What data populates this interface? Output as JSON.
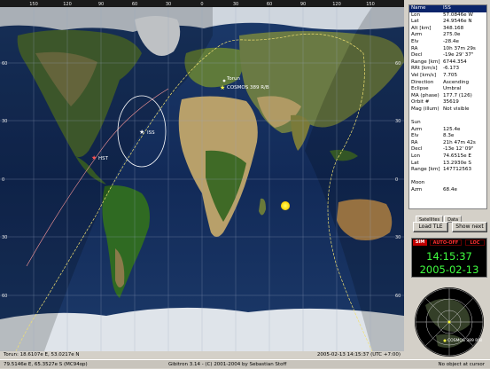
{
  "map": {
    "top_ticks": [
      "150",
      "120",
      "90",
      "60",
      "30",
      "0",
      "30",
      "60",
      "90",
      "120",
      "150"
    ],
    "side_ticks": [
      "60",
      "30",
      "0",
      "30",
      "60"
    ],
    "satellites": [
      {
        "name": "ISS",
        "color": "#ffffff"
      },
      {
        "name": "HST",
        "color": "#ff6a6a"
      },
      {
        "name": "COSMOS 389 R/B",
        "color": "#ffff40"
      }
    ],
    "ground_station": "Torun",
    "sun_color": "#ffd700",
    "status_left": "Torun: 18.6107e E, 53.0217e N",
    "status_right": "2005-02-13 14:15:37 (UTC +7:00)"
  },
  "bottom_status": {
    "cursor": "79.5146e E, 65.3527e S (MC94op)",
    "title": "Gibitron 3.14 - (C) 2001-2004 by Sebastian Stoff",
    "object": "No object at cursor"
  },
  "info": {
    "rows": [
      {
        "k": "Name",
        "v": "ISS",
        "selected": true
      },
      {
        "k": "Lon",
        "v": "57.0846e W"
      },
      {
        "k": "Lat",
        "v": "24.9546e N"
      },
      {
        "k": "Alt [km]",
        "v": "348.168"
      },
      {
        "k": "Azm",
        "v": "275.0e"
      },
      {
        "k": "Elv",
        "v": "-28.4e"
      },
      {
        "k": "RA",
        "v": "10h 37m 29s"
      },
      {
        "k": "Decl",
        "v": "-19e 29' 37\""
      },
      {
        "k": "Range [km]",
        "v": "6744.354"
      },
      {
        "k": "RRt [km/s]",
        "v": "-6.173"
      },
      {
        "k": "Vel [km/s]",
        "v": "7.705"
      },
      {
        "k": "Direction",
        "v": "Ascending"
      },
      {
        "k": "Eclipse",
        "v": "Umbral"
      },
      {
        "k": "MA (phase)",
        "v": "177.7 (126)"
      },
      {
        "k": "Orbit #",
        "v": "35619"
      },
      {
        "k": "Mag (illum)",
        "v": "Not visible"
      },
      {
        "gap": true
      },
      {
        "k": "Sun",
        "v": ""
      },
      {
        "k": "Azm",
        "v": "125.4e"
      },
      {
        "k": "Elv",
        "v": "8.3e"
      },
      {
        "k": "RA",
        "v": "21h 47m 42s"
      },
      {
        "k": "Decl",
        "v": "-13e 12' 09\""
      },
      {
        "k": "Lon",
        "v": "74.6515e E"
      },
      {
        "k": "Lat",
        "v": "13.2930e S"
      },
      {
        "k": "Range [km]",
        "v": "147712563"
      },
      {
        "gap": true
      },
      {
        "k": "Moon",
        "v": ""
      },
      {
        "k": "Azm",
        "v": "68.4e"
      }
    ]
  },
  "tabs": [
    "Satellites",
    "Data"
  ],
  "buttons": {
    "load_tle": "Load TLE",
    "show_next": "Show next"
  },
  "clock": {
    "mode_sim": "SIM",
    "mode_auto": "AUTO-OFF",
    "mode_loc": "LOC",
    "time": "14:15:37",
    "date": "2005-02-13"
  },
  "radar": {
    "label": "COSMOS 389 R/B"
  }
}
